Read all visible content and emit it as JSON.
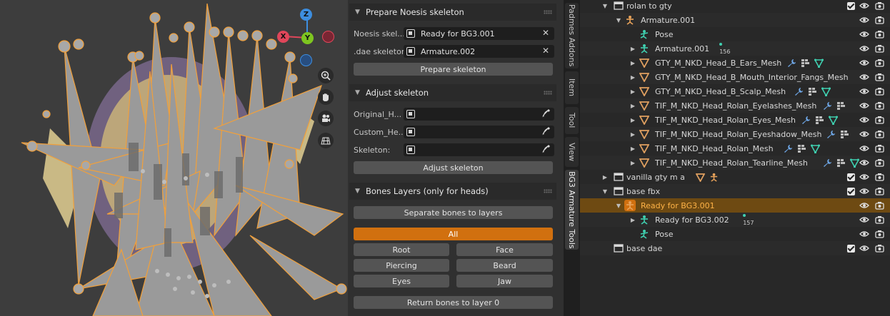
{
  "npanel": {
    "prepare": {
      "title": "Prepare Noesis skeleton",
      "noesis_label": "Noesis skel...",
      "noesis_value": "Ready for BG3.001",
      "dae_label": ".dae skeleton:",
      "dae_value": "Armature.002",
      "button": "Prepare skeleton"
    },
    "adjust": {
      "title": "Adjust skeleton",
      "original_label": "Original_H...",
      "custom_label": "Custom_He...",
      "skeleton_label": "Skeleton:",
      "button": "Adjust skeleton"
    },
    "layers": {
      "title": "Bones Layers (only for heads)",
      "separate_button": "Separate bones to layers",
      "all_button": "All",
      "buttons": [
        "Root",
        "Face",
        "Piercing",
        "Beard",
        "Eyes",
        "Jaw"
      ],
      "return_button": "Return bones to layer 0"
    }
  },
  "side_tabs": [
    "Padmes Addons",
    "Item",
    "Tool",
    "View",
    "BG3 Armature Tools"
  ],
  "side_tab_active": "BG3 Armature Tools",
  "outliner": {
    "rows": [
      {
        "name": "rolan to gty",
        "type": "collection"
      },
      {
        "name": "Armature.001",
        "type": "armature"
      },
      {
        "name": "Pose",
        "type": "pose"
      },
      {
        "name": "Armature.001",
        "type": "armature-data",
        "badge": "156"
      },
      {
        "name": "GTY_M_NKD_Head_B_Ears_Mesh",
        "type": "mesh"
      },
      {
        "name": "GTY_M_NKD_Head_B_Mouth_Interior_Fangs_Mesh",
        "type": "mesh"
      },
      {
        "name": "GTY_M_NKD_Head_B_Scalp_Mesh",
        "type": "mesh"
      },
      {
        "name": "TIF_M_NKD_Head_Rolan_Eyelashes_Mesh",
        "type": "mesh"
      },
      {
        "name": "TIF_M_NKD_Head_Rolan_Eyes_Mesh",
        "type": "mesh"
      },
      {
        "name": "TIF_M_NKD_Head_Rolan_Eyeshadow_Mesh",
        "type": "mesh"
      },
      {
        "name": "TIF_M_NKD_Head_Rolan_Mesh",
        "type": "mesh"
      },
      {
        "name": "TIF_M_NKD_Head_Rolan_Tearline_Mesh",
        "type": "mesh"
      },
      {
        "name": "vanilla gty m a",
        "type": "collection"
      },
      {
        "name": "base fbx",
        "type": "collection"
      },
      {
        "name": "Ready for BG3.001",
        "type": "armature"
      },
      {
        "name": "Ready for BG3.002",
        "type": "armature-data",
        "badge": "157"
      },
      {
        "name": "Pose",
        "type": "pose"
      },
      {
        "name": "base dae",
        "type": "collection"
      }
    ]
  },
  "colors": {
    "accent": "#d1700f",
    "selection": "#6e4a12",
    "mesh_icon": "#e0a060",
    "armature_icon": "#e9a35a",
    "bone_icon": "#3fd0b0",
    "modifier_icon": "#6fa8e8",
    "gizmo_x": "#e0465a",
    "gizmo_y": "#7ec620",
    "gizmo_z": "#3d8ee0"
  },
  "gizmo": {
    "x": "X",
    "y": "Y",
    "z": "Z"
  }
}
